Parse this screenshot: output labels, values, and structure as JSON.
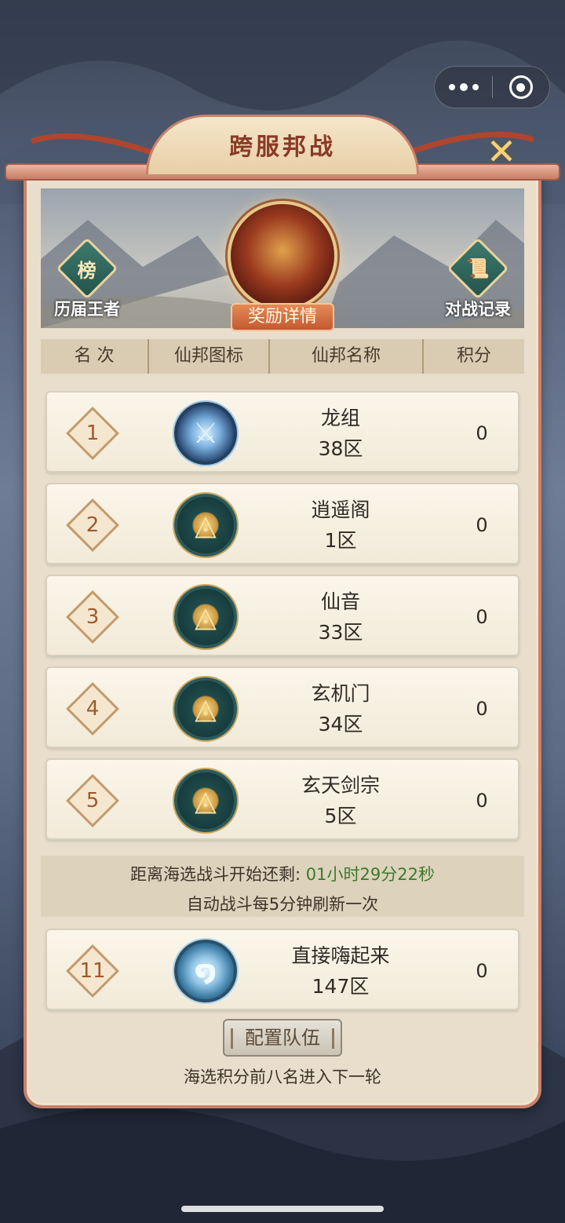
{
  "capsule": {
    "more_icon": "more-dots-icon",
    "close_icon": "target-close-icon"
  },
  "title": "跨服邦战",
  "close_icon": "close-x-icon",
  "banner": {
    "left_button": {
      "icon_char": "榜",
      "label": "历届王者"
    },
    "right_button": {
      "icon_char": "📜",
      "label": "对战记录"
    },
    "reward_button": "奖励详情"
  },
  "table": {
    "headers": [
      "名 次",
      "仙邦图标",
      "仙邦名称",
      "积分"
    ],
    "rows": [
      {
        "rank": "1",
        "name": "龙组",
        "zone": "38区",
        "score": "0",
        "emblem": "blue-swords",
        "glyph": "⚔"
      },
      {
        "rank": "2",
        "name": "逍遥阁",
        "zone": "1区",
        "score": "0",
        "emblem": "gold-triangle",
        "glyph": "◬"
      },
      {
        "rank": "3",
        "name": "仙音",
        "zone": "33区",
        "score": "0",
        "emblem": "gold-triangle",
        "glyph": "◬"
      },
      {
        "rank": "4",
        "name": "玄机门",
        "zone": "34区",
        "score": "0",
        "emblem": "gold-triangle",
        "glyph": "◬"
      },
      {
        "rank": "5",
        "name": "玄天剑宗",
        "zone": "5区",
        "score": "0",
        "emblem": "gold-triangle",
        "glyph": "◬"
      }
    ]
  },
  "countdown": {
    "prefix": "距离海选战斗开始还剩: ",
    "time": "01小时29分22秒",
    "note": "自动战斗每5分钟刷新一次"
  },
  "my_row": {
    "rank": "11",
    "name": "直接嗨起来",
    "zone": "147区",
    "score": "0",
    "emblem": "blue-swirl",
    "glyph": "໑"
  },
  "team_button": "配置队伍",
  "footnote": "海选积分前八名进入下一轮"
}
